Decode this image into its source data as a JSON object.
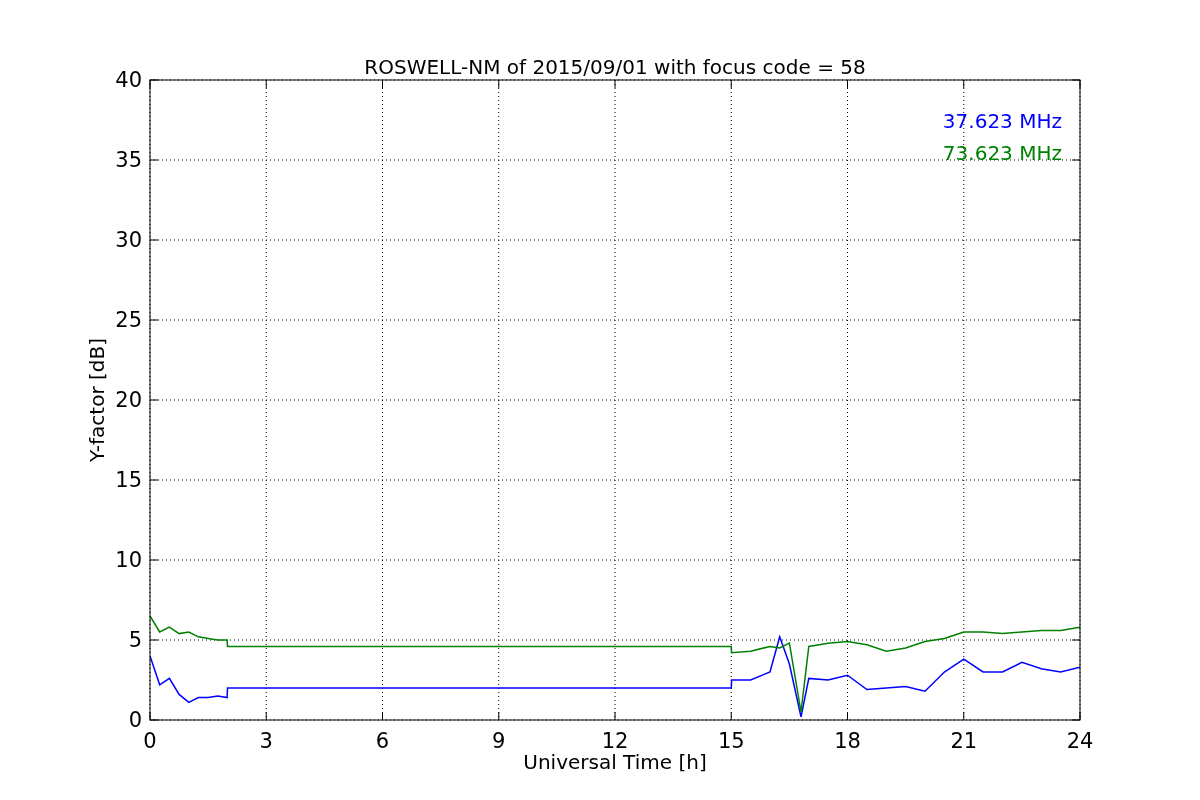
{
  "plot": {
    "chart_data": {
      "type": "line",
      "title": "ROSWELL-NM of 2015/09/01 with focus code = 58",
      "xlabel": "Universal Time [h]",
      "ylabel": "Y-factor [dB]",
      "x": [
        0,
        0.25,
        0.5,
        0.75,
        1,
        1.25,
        1.5,
        1.75,
        1.99,
        2,
        15,
        15.01,
        15.5,
        16,
        16.25,
        16.5,
        16.8,
        17,
        17.5,
        18,
        18.5,
        19,
        19.5,
        20,
        20.5,
        21,
        21.5,
        22,
        22.5,
        23,
        23.5,
        24
      ],
      "series": [
        {
          "name": "37.623 MHz",
          "color": "#0000ff",
          "values": [
            4.0,
            2.2,
            2.6,
            1.6,
            1.1,
            1.4,
            1.4,
            1.5,
            1.4,
            2.0,
            2.0,
            2.5,
            2.5,
            3.0,
            5.2,
            3.5,
            0.2,
            2.6,
            2.5,
            2.8,
            1.9,
            2.0,
            2.1,
            1.8,
            3.0,
            3.8,
            3.0,
            3.0,
            3.6,
            3.2,
            3.0,
            3.3
          ]
        },
        {
          "name": "73.623 MHz",
          "color": "#008000",
          "values": [
            6.5,
            5.5,
            5.8,
            5.4,
            5.5,
            5.2,
            5.1,
            5.0,
            5.0,
            4.6,
            4.6,
            4.2,
            4.3,
            4.6,
            4.5,
            4.8,
            0.5,
            4.6,
            4.8,
            4.9,
            4.7,
            4.3,
            4.5,
            4.9,
            5.1,
            5.5,
            5.5,
            5.4,
            5.5,
            5.6,
            5.6,
            5.8
          ]
        }
      ],
      "grid": true,
      "xlim": [
        0,
        24
      ],
      "ylim": [
        0,
        40
      ],
      "xticks": [
        0,
        3,
        6,
        9,
        12,
        15,
        18,
        21,
        24
      ],
      "yticks": [
        0,
        5,
        10,
        15,
        20,
        25,
        30,
        35,
        40
      ]
    }
  }
}
